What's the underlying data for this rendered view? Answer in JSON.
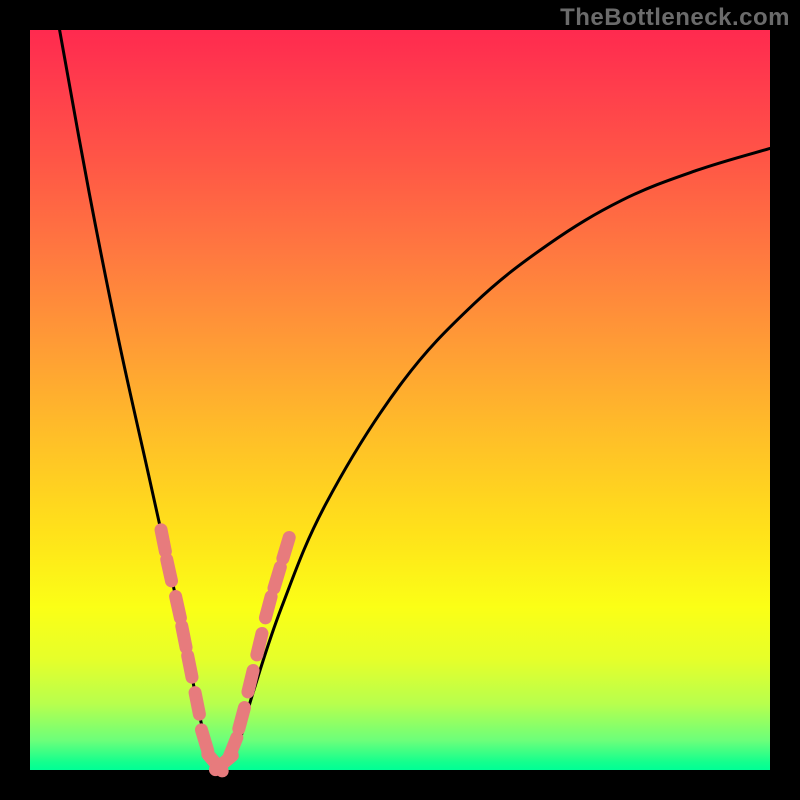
{
  "watermark": "TheBottleneck.com",
  "colors": {
    "frame": "#000000",
    "curve": "#000000",
    "marker_fill": "#e77b7d",
    "marker_stroke": "#d46466"
  },
  "chart_data": {
    "type": "line",
    "title": "",
    "xlabel": "",
    "ylabel": "",
    "xlim": [
      0,
      100
    ],
    "ylim": [
      0,
      100
    ],
    "note": "No axis ticks or labels are rendered. Curve is a V-shaped bottleneck curve reaching ~0 (green) near x≈25 and rising toward red at both x extremes. Background hue encodes the y-value qualitatively (red=high, green=low).",
    "series": [
      {
        "name": "bottleneck-curve",
        "x": [
          4,
          8,
          12,
          16,
          20,
          22,
          24,
          26,
          28,
          30,
          34,
          40,
          50,
          60,
          70,
          80,
          90,
          100
        ],
        "y": [
          100,
          78,
          58,
          40,
          22,
          12,
          3,
          1,
          3,
          10,
          22,
          36,
          52,
          63,
          71,
          77,
          81,
          84
        ]
      }
    ],
    "markers": {
      "name": "highlight-segments",
      "note": "Short thick salmon strokes overlaid on the curve near the valley on both sides.",
      "points": [
        {
          "x": 18.0,
          "y": 31
        },
        {
          "x": 18.8,
          "y": 27
        },
        {
          "x": 20.0,
          "y": 22
        },
        {
          "x": 20.8,
          "y": 18
        },
        {
          "x": 21.6,
          "y": 14
        },
        {
          "x": 22.6,
          "y": 9
        },
        {
          "x": 23.6,
          "y": 4
        },
        {
          "x": 25.0,
          "y": 1
        },
        {
          "x": 26.2,
          "y": 1
        },
        {
          "x": 27.4,
          "y": 3
        },
        {
          "x": 28.6,
          "y": 7
        },
        {
          "x": 29.8,
          "y": 12
        },
        {
          "x": 31.0,
          "y": 17
        },
        {
          "x": 32.2,
          "y": 22
        },
        {
          "x": 33.4,
          "y": 26
        },
        {
          "x": 34.6,
          "y": 30
        }
      ]
    }
  }
}
